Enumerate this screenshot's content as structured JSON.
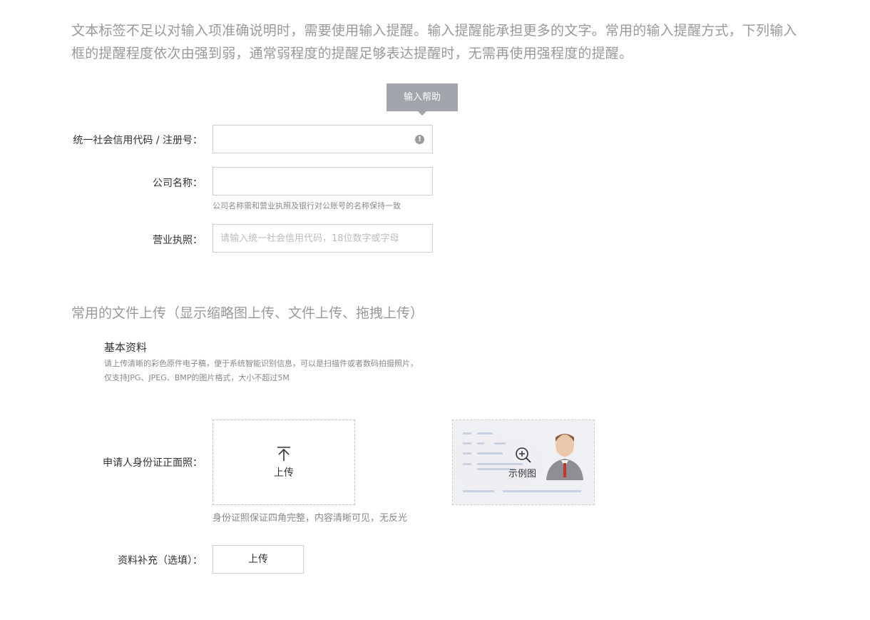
{
  "intro_text": "文本标签不足以对输入项准确说明时，需要使用输入提醒。输入提醒能承担更多的文字。常用的输入提醒方式，下列输入框的提醒程度依次由强到弱，通常弱程度的提醒足够表达提醒时，无需再使用强程度的提醒。",
  "tooltip": {
    "text": "输入帮助"
  },
  "form": {
    "credit_code": {
      "label": "统一社会信用代码 / 注册号：",
      "value": "",
      "icon": "exclamation-icon"
    },
    "company_name": {
      "label": "公司名称：",
      "value": "",
      "hint": "公司名称需和营业执照及银行对公账号的名称保持一致"
    },
    "business_license": {
      "label": "营业执照：",
      "value": "",
      "placeholder": "请输入统一社会信用代码，18位数字或字母"
    }
  },
  "upload_section": {
    "title": "常用的文件上传（显示缩略图上传、文件上传、拖拽上传）",
    "basic": {
      "title": "基本资料",
      "desc_line1": "请上传清晰的彩色原件电子稿，便于系统智能识别信息，可以是扫描件或者数码拍摄照片，",
      "desc_line2": "仅支持JPG、JPEG、BMP的图片格式，大小不超过5M"
    },
    "id_front": {
      "label": "申请人身份证正面照：",
      "upload_label": "上传",
      "upload_icon": "upload-arrow-icon",
      "sample_label": "示例图",
      "sample_icon": "zoom-in-icon",
      "hint": "身份证照保证四角完整，内容清晰可见，无反光"
    },
    "supplement": {
      "label": "资料补充（选填）：",
      "button_label": "上传"
    }
  },
  "colors": {
    "tooltip_bg": "#a2a5ab",
    "border": "#cfcfcf",
    "muted_text": "#999999"
  }
}
